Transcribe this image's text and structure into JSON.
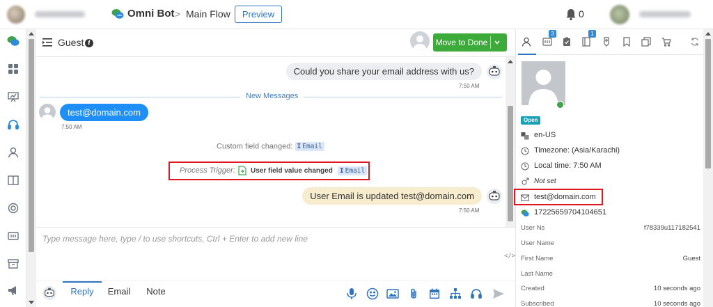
{
  "topbar": {
    "bot_name": "Omni Bot",
    "separator": ">",
    "flow_name": "Main Flow",
    "preview_label": "Preview",
    "notification_count": "0"
  },
  "chat_header": {
    "title": "Guest",
    "info_icon": "i",
    "done_label": "Move to Done"
  },
  "messages": [
    {
      "sender": "bot",
      "text": "Could you share your email address with us?",
      "time": "7:50 AM"
    },
    {
      "sender": "user",
      "text": "test@domain.com",
      "time": "7:50 AM"
    },
    {
      "sender": "bot",
      "text": "User Email is updated test@domain.com",
      "time": "7:50 AM"
    }
  ],
  "new_messages_label": "New Messages",
  "system_events": {
    "custom_field_prefix": "Custom field changed:",
    "custom_field_chip": "Email",
    "process_trigger_prefix": "Process Trigger:",
    "process_trigger_action": "User field value changed",
    "process_trigger_chip": "Email"
  },
  "composer": {
    "placeholder": "Type message here, type / to use shortcuts, Ctrl + Enter to add new line",
    "code_toggle": "</>",
    "tabs": [
      "Reply",
      "Email",
      "Note"
    ],
    "active_tab": "Reply"
  },
  "right_panel": {
    "tab_badges": {
      "tab2": "3",
      "tab4": "1"
    },
    "status": "Open",
    "locale": "en-US",
    "timezone": "Timezone: (Asia/Karachi)",
    "local_time": "Local time: 7:50 AM",
    "gender": "Not set",
    "email": "test@domain.com",
    "phone": "17225659704104651",
    "fields": [
      {
        "label": "User Ns",
        "value": "f78339u117182541"
      },
      {
        "label": "User Name",
        "value": ""
      },
      {
        "label": "First Name",
        "value": "Guest"
      },
      {
        "label": "Last Name",
        "value": ""
      },
      {
        "label": "Created",
        "value": "10 seconds ago"
      },
      {
        "label": "Subscribed",
        "value": "10 seconds ago"
      }
    ]
  },
  "colors": {
    "accent": "#2f74c0",
    "done_green": "#3dab3a",
    "user_bubble": "#1e8ff7",
    "highlight_red": "#e0171e",
    "status_open": "#17a2b8"
  }
}
